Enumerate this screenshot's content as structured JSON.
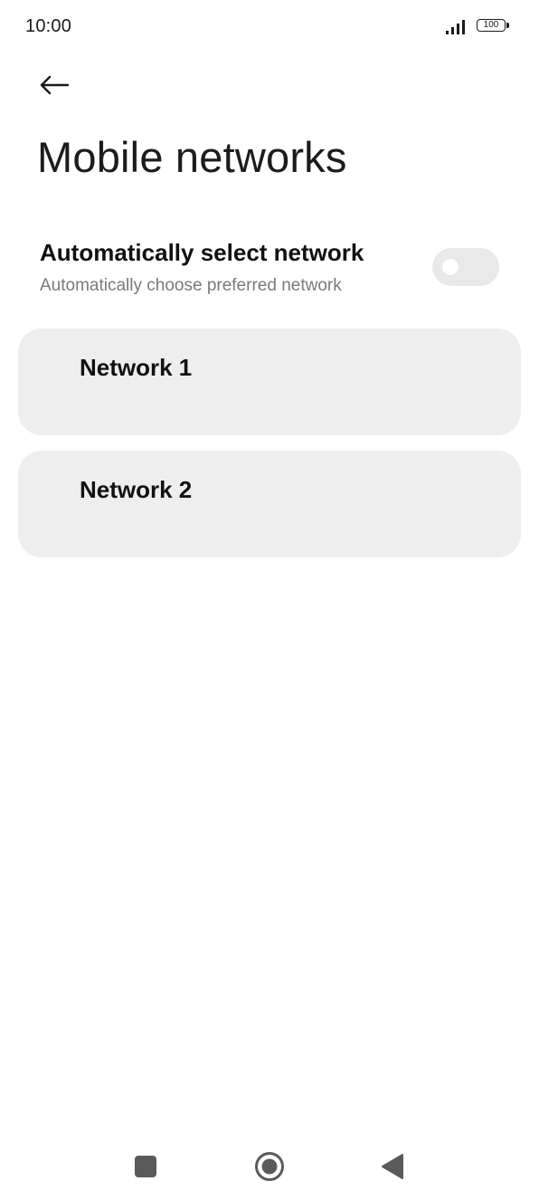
{
  "status_bar": {
    "time": "10:00",
    "signal_icon": "signal-bars-icon",
    "battery_level": "100"
  },
  "header": {
    "back_icon": "arrow-left-icon",
    "title": "Mobile networks"
  },
  "auto_select": {
    "title": "Automatically select network",
    "subtitle": "Automatically choose preferred network",
    "enabled": false
  },
  "networks": [
    {
      "label": "Network 1"
    },
    {
      "label": "Network 2"
    }
  ],
  "nav_bar": {
    "recents_icon": "square-icon",
    "home_icon": "circle-home-icon",
    "back_icon": "triangle-back-icon"
  },
  "colors": {
    "card_background": "#eeeeee",
    "toggle_off": "#e9e9e9",
    "subtitle_text": "#7a7a7a"
  }
}
